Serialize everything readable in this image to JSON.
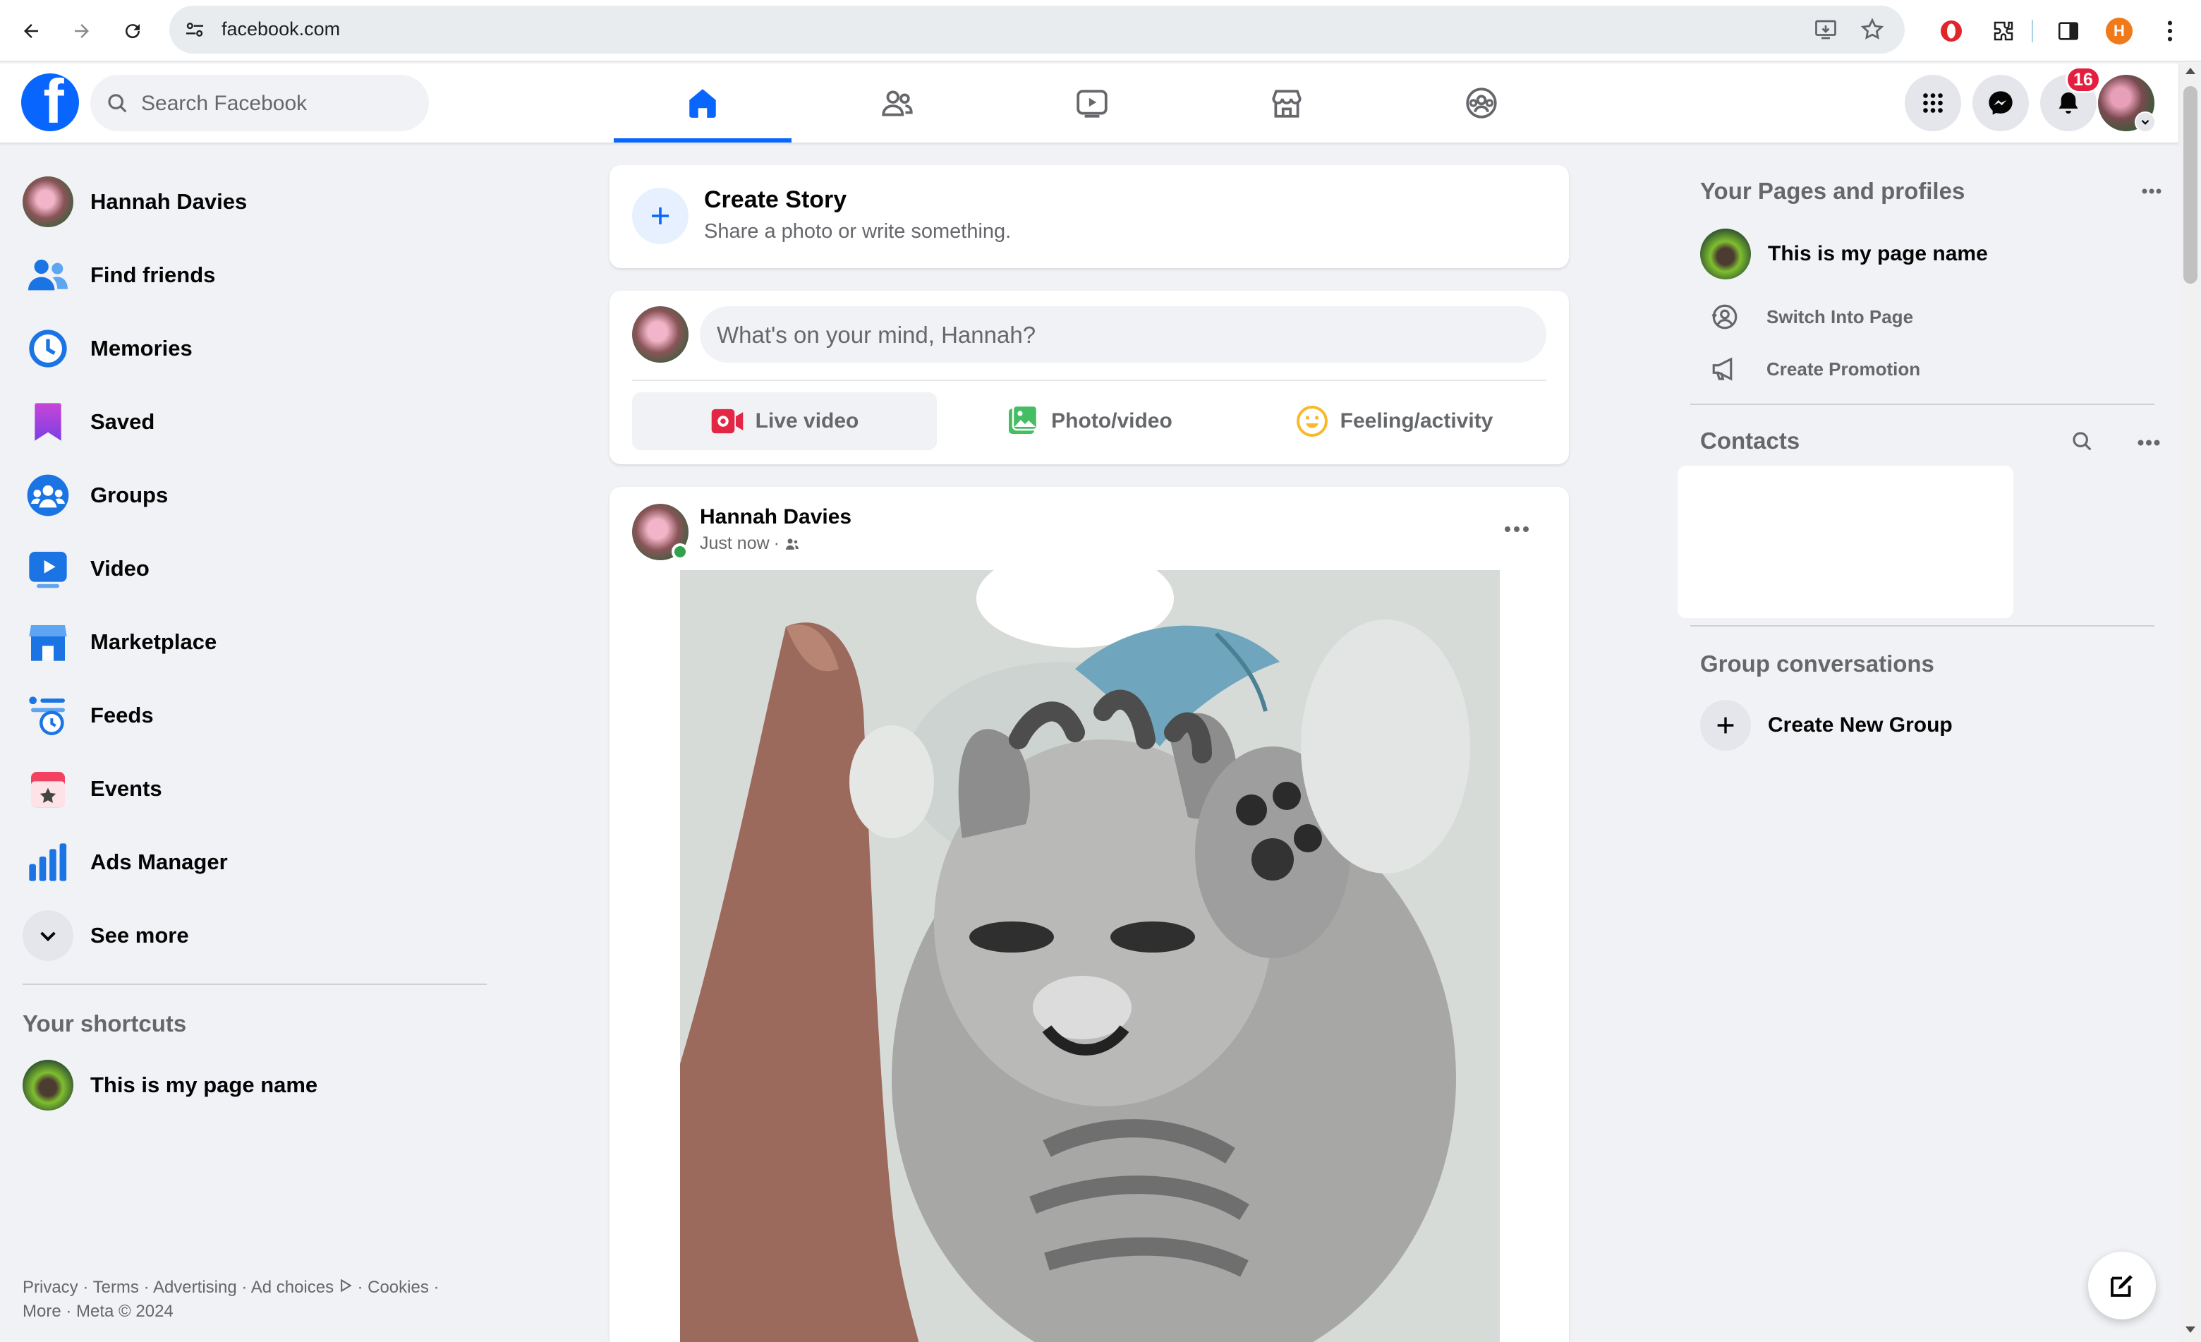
{
  "browser": {
    "url": "facebook.com",
    "profile_initial": "H"
  },
  "header": {
    "logo_letter": "f",
    "search_placeholder": "Search Facebook",
    "notification_count": "16",
    "colors": {
      "brand": "#0866ff",
      "badge": "#e41e3f"
    }
  },
  "sidebar": {
    "items": [
      {
        "label": "Hannah Davies",
        "icon": "profile-avatar"
      },
      {
        "label": "Find friends",
        "icon": "friends-icon"
      },
      {
        "label": "Memories",
        "icon": "memories-clock-icon"
      },
      {
        "label": "Saved",
        "icon": "bookmark-icon"
      },
      {
        "label": "Groups",
        "icon": "groups-icon"
      },
      {
        "label": "Video",
        "icon": "video-icon"
      },
      {
        "label": "Marketplace",
        "icon": "marketplace-icon"
      },
      {
        "label": "Feeds",
        "icon": "feeds-icon"
      },
      {
        "label": "Events",
        "icon": "events-icon"
      },
      {
        "label": "Ads Manager",
        "icon": "ads-manager-icon"
      },
      {
        "label": "See more",
        "icon": "chevron-down-icon"
      }
    ],
    "shortcuts_title": "Your shortcuts",
    "shortcuts": [
      {
        "label": "This is my page name"
      }
    ],
    "footer": {
      "links": [
        "Privacy",
        "Terms",
        "Advertising",
        "Ad choices",
        "Cookies",
        "More"
      ],
      "copyright": "Meta © 2024"
    }
  },
  "feed": {
    "create_story": {
      "title": "Create Story",
      "subtitle": "Share a photo or write something."
    },
    "composer": {
      "placeholder": "What's on your mind, Hannah?",
      "actions": [
        {
          "label": "Live video",
          "color": "#e42645"
        },
        {
          "label": "Photo/video",
          "color": "#45bd62"
        },
        {
          "label": "Feeling/activity",
          "color": "#f7b928"
        }
      ]
    },
    "post": {
      "author": "Hannah Davies",
      "time": "Just now",
      "audience_sep": "·"
    }
  },
  "right": {
    "pages_title": "Your Pages and profiles",
    "page_name": "This is my page name",
    "page_actions": [
      "Switch Into Page",
      "Create Promotion"
    ],
    "contacts_title": "Contacts",
    "group_conv_title": "Group conversations",
    "create_group": "Create New Group"
  }
}
